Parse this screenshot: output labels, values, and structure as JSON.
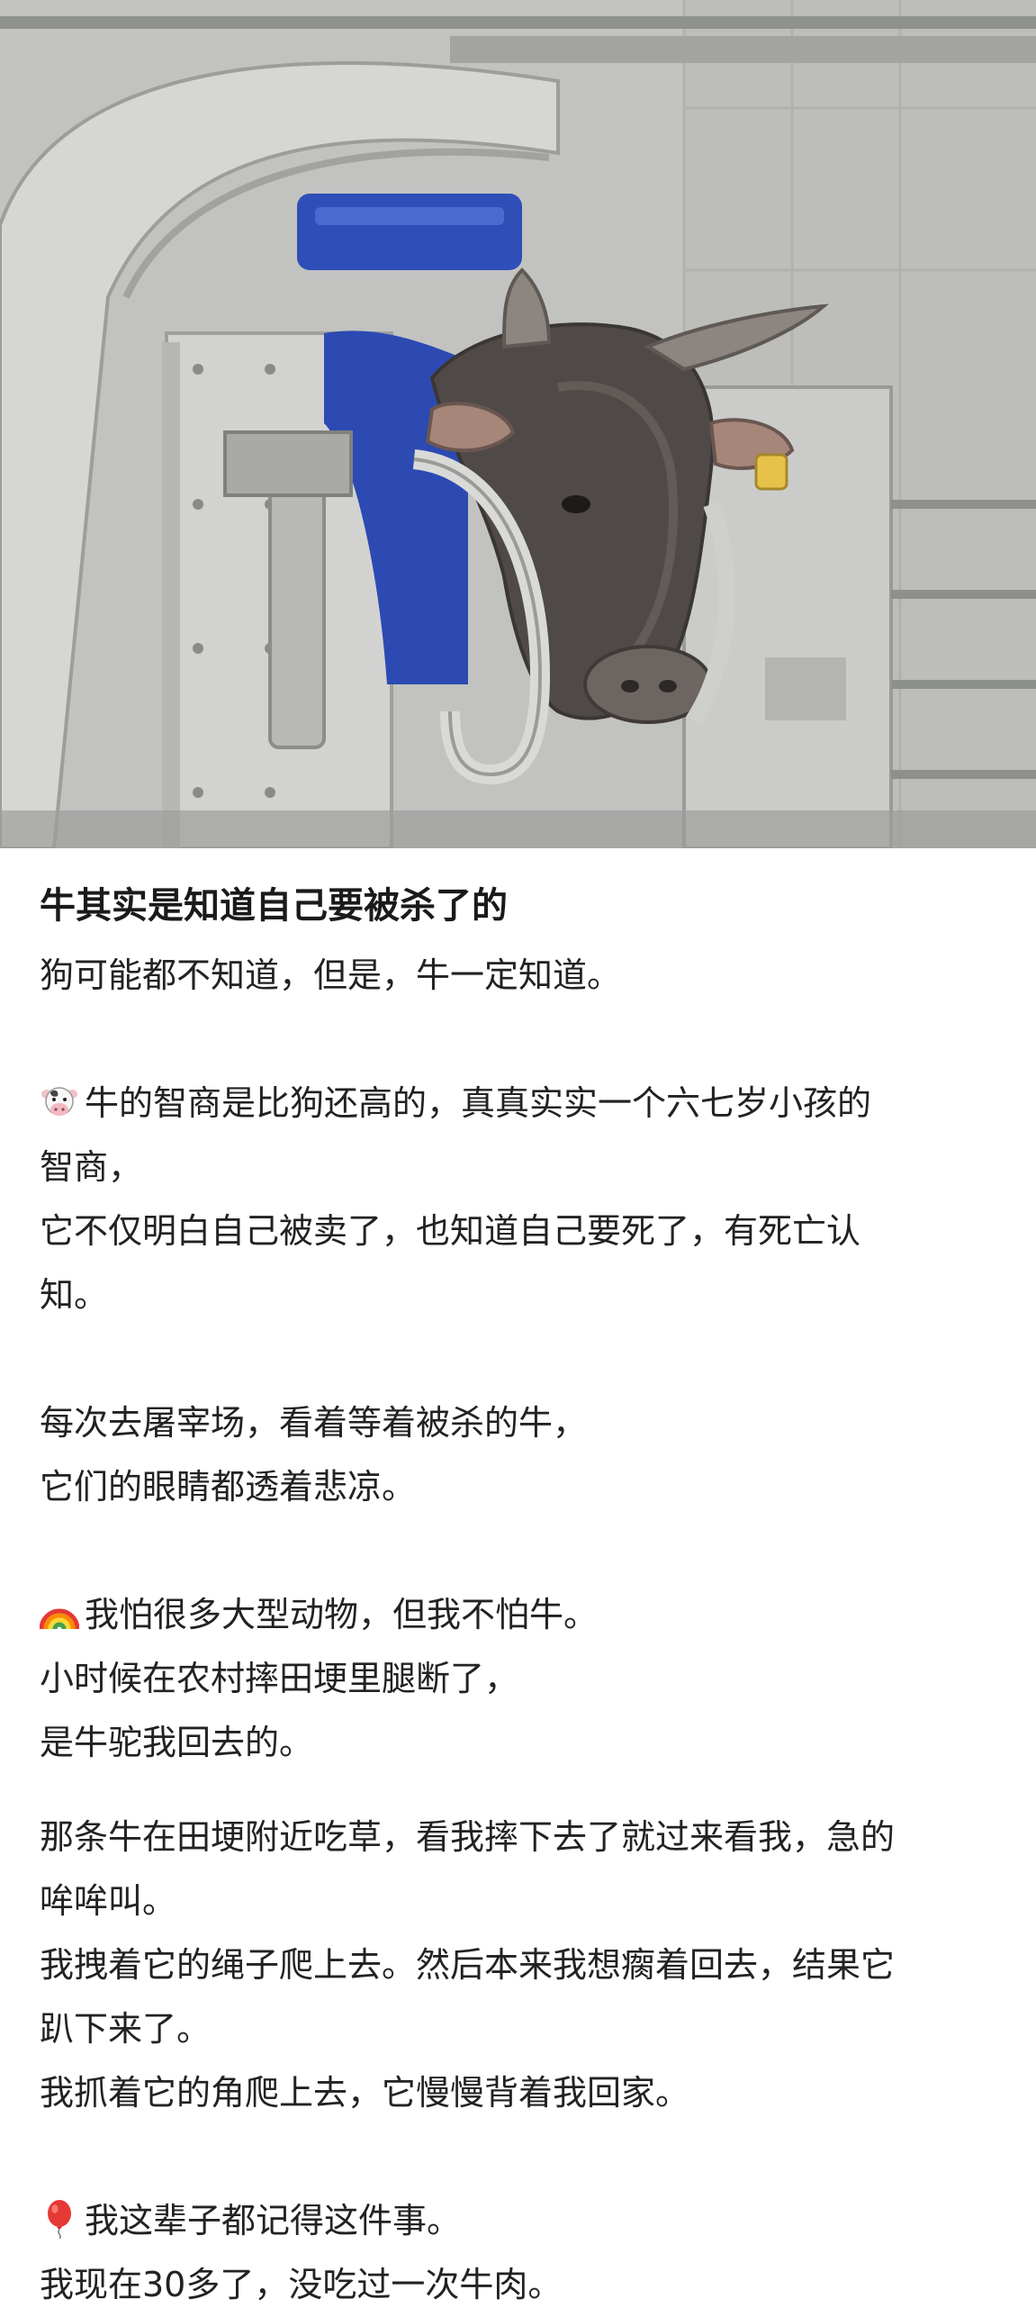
{
  "post": {
    "title": "牛其实是知道自己要被杀了的",
    "lines": {
      "p1": "狗可能都不知道，但是，牛一定知道。",
      "p2a": "牛的智商是比狗还高的，真真实实一个六七岁小孩的",
      "p2b": "智商，",
      "p2c": "它不仅明白自己被卖了，也知道自己要死了，有死亡认",
      "p2d": "知。",
      "p3a": "每次去屠宰场，看着等着被杀的牛，",
      "p3b": "它们的眼睛都透着悲凉。",
      "p4a": "我怕很多大型动物，但我不怕牛。",
      "p4b": "小时候在农村摔田埂里腿断了，",
      "p4c": "是牛驼我回去的。",
      "p5a": "那条牛在田埂附近吃草，看我摔下去了就过来看我，急的",
      "p5b": "哞哞叫。",
      "p5c": "我拽着它的绳子爬上去。然后本来我想瘸着回去，结果它",
      "p5d": "趴下来了。",
      "p5e": "我抓着它的角爬上去，它慢慢背着我回家。",
      "p6a": "我这辈子都记得这件事。",
      "p6b": "我现在30多了，没吃过一次牛肉。"
    },
    "icons": {
      "cow": "cow-face-icon",
      "rainbow": "rainbow-icon",
      "balloon": "balloon-icon"
    }
  },
  "colors": {
    "text": "#222222",
    "title": "#1a1a1a",
    "background": "#ffffff",
    "restraint_blue": "#2e4fb8",
    "steel": "#c4c6c4"
  }
}
